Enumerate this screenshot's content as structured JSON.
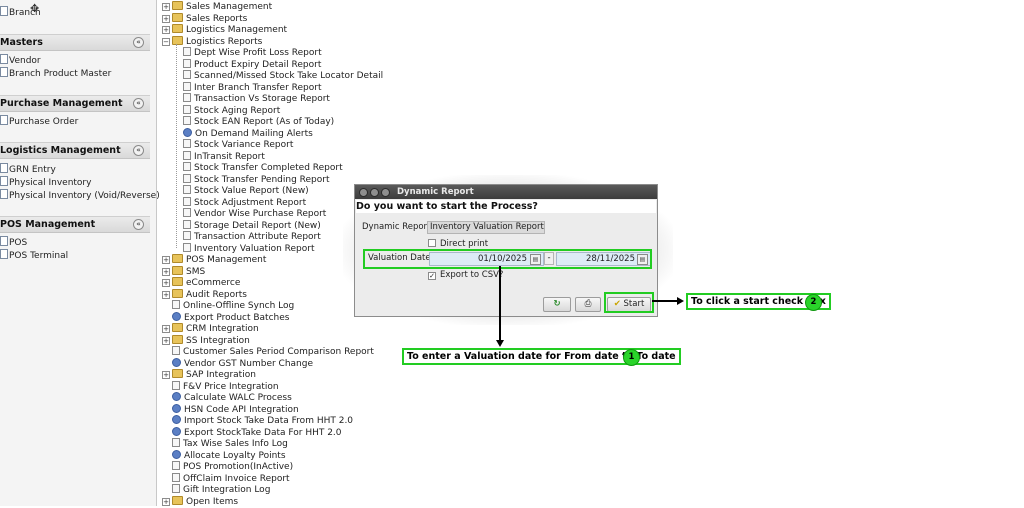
{
  "left_panel": {
    "top_item": "Branch",
    "sections": [
      {
        "title": "Masters",
        "items": [
          "Vendor",
          "Branch Product Master"
        ]
      },
      {
        "title": "Purchase Management",
        "items": [
          "Purchase Order"
        ]
      },
      {
        "title": "Logistics Management",
        "items": [
          "GRN Entry",
          "Physical Inventory",
          "Physical Inventory (Void/Reverse)"
        ]
      },
      {
        "title": "POS Management",
        "items": [
          "POS",
          "POS Terminal"
        ]
      }
    ],
    "collapse_glyph": "«"
  },
  "tree": {
    "items": [
      {
        "label": "Sales Management",
        "icon": "folder"
      },
      {
        "label": "Sales Reports",
        "icon": "folder"
      },
      {
        "label": "Logistics Management",
        "icon": "folder"
      },
      {
        "label": "Logistics Reports",
        "icon": "folder-open"
      },
      {
        "label": "Dept Wise Profit Loss Report",
        "icon": "page",
        "child": true
      },
      {
        "label": "Product Expiry Detail Report",
        "icon": "page",
        "child": true
      },
      {
        "label": "Scanned/Missed Stock Take Locator Detail",
        "icon": "page",
        "child": true
      },
      {
        "label": "Inter Branch Transfer Report",
        "icon": "page",
        "child": true
      },
      {
        "label": "Transaction Vs Storage Report",
        "icon": "page",
        "child": true
      },
      {
        "label": "Stock Aging Report",
        "icon": "page",
        "child": true
      },
      {
        "label": "Stock EAN Report (As of Today)",
        "icon": "page",
        "child": true
      },
      {
        "label": "On Demand Mailing Alerts",
        "icon": "gear",
        "child": true
      },
      {
        "label": "Stock Variance Report",
        "icon": "page",
        "child": true
      },
      {
        "label": "InTransit Report",
        "icon": "page",
        "child": true
      },
      {
        "label": "Stock Transfer Completed Report",
        "icon": "page",
        "child": true
      },
      {
        "label": "Stock Transfer Pending Report",
        "icon": "page",
        "child": true
      },
      {
        "label": "Stock Value Report (New)",
        "icon": "page",
        "child": true
      },
      {
        "label": "Stock Adjustment Report",
        "icon": "page",
        "child": true
      },
      {
        "label": "Vendor Wise Purchase Report",
        "icon": "page",
        "child": true
      },
      {
        "label": "Storage Detail Report (New)",
        "icon": "page",
        "child": true
      },
      {
        "label": "Transaction Attribute Report",
        "icon": "page",
        "child": true
      },
      {
        "label": "Inventory Valuation Report",
        "icon": "page",
        "child": true
      },
      {
        "label": "POS Management",
        "icon": "folder"
      },
      {
        "label": "SMS",
        "icon": "folder"
      },
      {
        "label": "eCommerce",
        "icon": "folder"
      },
      {
        "label": "Audit Reports",
        "icon": "folder"
      },
      {
        "label": "Online-Offline Synch Log",
        "icon": "page"
      },
      {
        "label": "Export Product Batches",
        "icon": "gear"
      },
      {
        "label": "CRM Integration",
        "icon": "folder"
      },
      {
        "label": "SS Integration",
        "icon": "folder"
      },
      {
        "label": "Customer Sales Period Comparison Report",
        "icon": "page"
      },
      {
        "label": "Vendor GST Number Change",
        "icon": "gear"
      },
      {
        "label": "SAP Integration",
        "icon": "folder"
      },
      {
        "label": "F&V Price Integration",
        "icon": "page"
      },
      {
        "label": "Calculate WALC Process",
        "icon": "gear"
      },
      {
        "label": "HSN Code API Integration",
        "icon": "gear"
      },
      {
        "label": "Import Stock Take Data From HHT 2.0",
        "icon": "gear"
      },
      {
        "label": "Export StockTake Data For HHT 2.0",
        "icon": "gear"
      },
      {
        "label": "Tax Wise Sales Info Log",
        "icon": "page"
      },
      {
        "label": "Allocate Loyalty Points",
        "icon": "gear"
      },
      {
        "label": "POS Promotion(InActive)",
        "icon": "page"
      },
      {
        "label": "OffClaim Invoice Report",
        "icon": "page"
      },
      {
        "label": "Gift Integration Log",
        "icon": "page"
      },
      {
        "label": "Open Items",
        "icon": "folder"
      }
    ]
  },
  "dialog": {
    "title": "Dynamic Report",
    "question": "Do you want to start the Process?",
    "report_label": "Dynamic Report",
    "report_value": "Inventory Valuation Report",
    "direct_print_label": "Direct print",
    "valuation_label": "Valuation Date",
    "from_date": "01/10/2025",
    "separator": "-",
    "to_date": "28/11/2025",
    "export_csv_label": "Export to CSV?",
    "export_csv_checked": true,
    "start_label": "Start"
  },
  "annotations": {
    "date_note": "To enter a Valuation date for From date to To date",
    "date_step": "1",
    "start_note": "To click  a start check box",
    "start_step": "2",
    "accent_color": "#22cc22"
  }
}
